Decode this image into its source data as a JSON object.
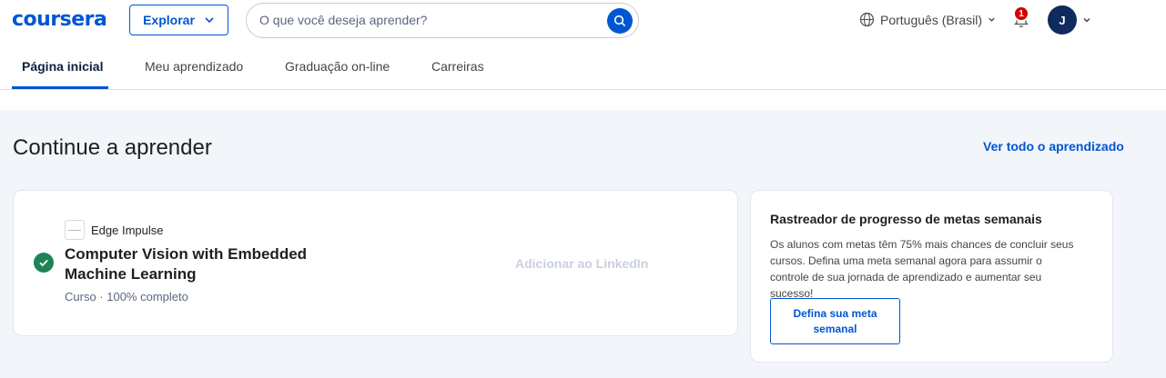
{
  "header": {
    "logo": "coursera",
    "explore_label": "Explorar",
    "search_placeholder": "O que você deseja aprender?",
    "language": "Português (Brasil)",
    "notifications_count": "1",
    "avatar_initial": "J"
  },
  "tabs": [
    {
      "label": "Página inicial",
      "active": true
    },
    {
      "label": "Meu aprendizado",
      "active": false
    },
    {
      "label": "Graduação on-line",
      "active": false
    },
    {
      "label": "Carreiras",
      "active": false
    }
  ],
  "main": {
    "section_title": "Continue a aprender",
    "see_all": "Ver todo o aprendizado",
    "course": {
      "partner": "Edge Impulse",
      "title": "Computer Vision with Embedded Machine Learning",
      "meta": "Curso · 100% completo",
      "progress_percent": 100,
      "linkedin_label": "Adicionar ao LinkedIn"
    },
    "tracker": {
      "title": "Rastreador de progresso de metas semanais",
      "description": "Os alunos com metas têm 75% mais chances de concluir seus cursos. Defina uma meta semanal agora para assumir o controle de sua jornada de aprendizado e aumentar seu sucesso!",
      "button_label": "Defina sua meta semanal"
    }
  },
  "colors": {
    "brand": "#0056d2",
    "background": "#f2f5fa",
    "success": "#1f8354",
    "badge": "#d30001"
  }
}
